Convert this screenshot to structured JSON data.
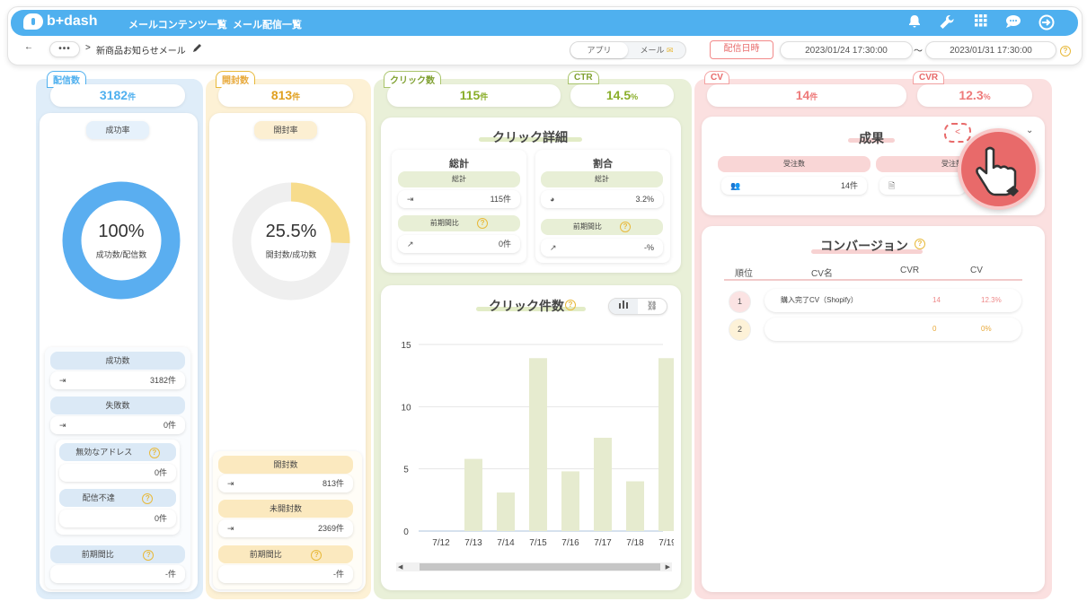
{
  "header": {
    "logo": "b+dash",
    "nav1": "メールコンテンツ一覧",
    "nav2": "メール配信一覧",
    "icons": [
      "bell-icon",
      "wrench-icon",
      "grid-icon",
      "chat-icon",
      "logout-icon"
    ]
  },
  "breadcrumb": {
    "back": "←",
    "dots": "•••",
    "sep": ">",
    "title": "新商品お知らせメール"
  },
  "toggle": {
    "app": "アプリ",
    "mail": "メール"
  },
  "date": {
    "button": "配信日時",
    "from": "2023/01/24 17:30:00",
    "tilde": "〜",
    "to": "2023/01/31 17:30:00"
  },
  "delivery": {
    "tab": "配信数",
    "value": "3182",
    "unit": "件",
    "rate_label": "成功率",
    "donut_pct": "100%",
    "donut_sub": "成功数/配信数",
    "donut_fraction": 1.0,
    "success_label": "成功数",
    "success_value": "3182件",
    "fail_label": "失敗数",
    "fail_value": "0件",
    "invalid_label": "無効なアドレス",
    "invalid_value": "0件",
    "undeliv_label": "配信不達",
    "undeliv_value": "0件",
    "prev_label": "前期間比",
    "prev_value": "-件"
  },
  "open": {
    "tab": "開封数",
    "value": "813",
    "unit": "件",
    "rate_label": "開封率",
    "donut_pct": "25.5%",
    "donut_sub": "開封数/成功数",
    "donut_fraction": 0.255,
    "open_label": "開封数",
    "open_value": "813件",
    "unopen_label": "未開封数",
    "unopen_value": "2369件",
    "prev_label": "前期間比",
    "prev_value": "-件"
  },
  "click": {
    "tab": "クリック数",
    "value": "115",
    "unit": "件",
    "ctr_tab": "CTR",
    "ctr_value": "14.5",
    "ctr_unit": "%",
    "detail_title": "クリック詳細",
    "total_title": "総計",
    "ratio_title": "割合",
    "total_label": "総計",
    "total_value": "115件",
    "ratio_total_label": "総計",
    "ratio_value": "3.2%",
    "prev_label": "前期間比",
    "prev_value": "0件",
    "ratio_prev_label": "前期間比",
    "ratio_prev_value": "-%",
    "count_title": "クリック件数"
  },
  "chart_data": {
    "type": "bar",
    "categories": [
      "7/12",
      "7/13",
      "7/14",
      "7/15",
      "7/16",
      "7/17",
      "7/18",
      "7/19"
    ],
    "values": [
      0,
      5.8,
      3.1,
      13.9,
      4.8,
      7.5,
      4.0,
      13.9
    ],
    "yticks": [
      0,
      5,
      10,
      15
    ],
    "ylim": [
      0,
      15
    ]
  },
  "cv": {
    "tab": "CV",
    "value": "14",
    "unit": "件",
    "cvr_tab": "CVR",
    "cvr_value": "12.3",
    "cvr_unit": "%",
    "result_title": "成果",
    "order_label": "受注数",
    "order_value": "14件",
    "order_label2": "受注数",
    "conv_title": "コンバージョン",
    "headers": [
      "順位",
      "CV名",
      "CVR",
      "CV"
    ],
    "rows": [
      {
        "rank": "1",
        "name": "購入完了CV（Shopify）",
        "cvr": "14",
        "cv": "12.3%"
      },
      {
        "rank": "2",
        "name": "",
        "cvr": "0",
        "cv": "0%"
      }
    ]
  },
  "colors": {
    "blue": "#4fb0ef",
    "yellow": "#f6d68a",
    "green": "#a9c46b",
    "pink": "#f4a3a3"
  }
}
